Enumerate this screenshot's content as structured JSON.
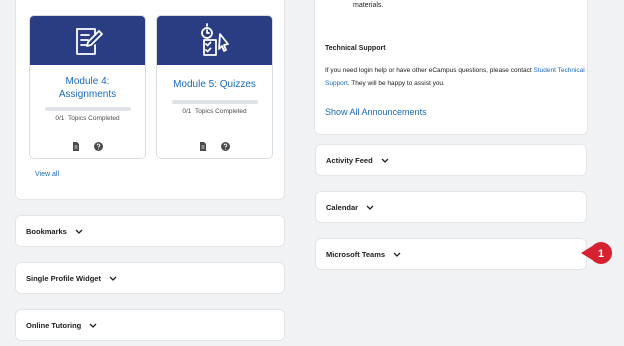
{
  "modules": [
    {
      "title_line1": "Module 4:",
      "title_line2": "Assignments",
      "progress_count": "0/1",
      "progress_label": "Topics Completed",
      "progress_fraction": 0
    },
    {
      "title_line1": "Module 5: Quizzes",
      "title_line2": "",
      "progress_count": "0/1",
      "progress_label": "Topics Completed",
      "progress_fraction": 0
    }
  ],
  "view_all": "View all",
  "left_widgets": [
    "Bookmarks",
    "Single Profile Widget",
    "Online Tutoring"
  ],
  "announcements": {
    "materials_text": "materials.",
    "tech_support_heading": "Technical Support",
    "tech_support_text_before": "If you need login help or have other eCampus questions, please contact",
    "tech_support_link": "Student Technical Support",
    "tech_support_text_after": ". They will be happy to assist you.",
    "show_all": "Show All Announcements"
  },
  "right_widgets": [
    "Activity Feed",
    "Calendar",
    "Microsoft Teams"
  ],
  "callout_number": "1",
  "colors": {
    "banner": "#2a3c82",
    "link": "#1a6bb8",
    "callout": "#d6222f"
  }
}
